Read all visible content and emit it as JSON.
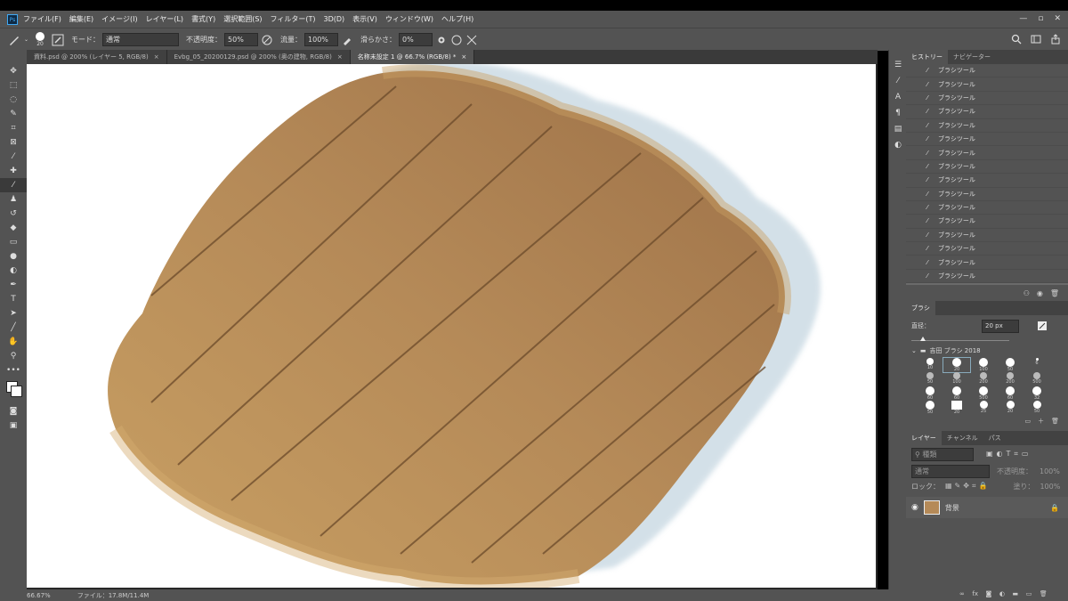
{
  "app": {
    "logo": "Ps"
  },
  "menu": [
    "ファイル(F)",
    "編集(E)",
    "イメージ(I)",
    "レイヤー(L)",
    "書式(Y)",
    "選択範囲(S)",
    "フィルター(T)",
    "3D(D)",
    "表示(V)",
    "ウィンドウ(W)",
    "ヘルプ(H)"
  ],
  "window_controls": [
    "—",
    "▫",
    "✕"
  ],
  "options": {
    "brush_size": "20",
    "mode_label": "モード：",
    "mode_value": "通常",
    "opacity_label": "不透明度：",
    "opacity_value": "50%",
    "flow_label": "流量：",
    "flow_value": "100%",
    "smoothing_label": "滑らかさ：",
    "smoothing_value": "0%"
  },
  "tabs": [
    {
      "label": "資料.psd @ 200% (レイヤー 5, RGB/8)",
      "active": false
    },
    {
      "label": "Evbg_05_20200129.psd @ 200% (奥の建物, RGB/8)",
      "active": false
    },
    {
      "label": "名称未設定 1 @ 66.7% (RGB/8) *",
      "active": true
    }
  ],
  "tab_close": "×",
  "status": {
    "zoom": "66.67%",
    "file": "ファイル：17.8M/11.4M"
  },
  "history": {
    "tab_history": "ヒストリー",
    "tab_navigator": "ナビゲーター",
    "item_label": "ブラシツール",
    "item_count": 17
  },
  "brush_panel": {
    "title": "ブラシ",
    "size_label": "直径：",
    "size_value": "20 px",
    "folder_name": "吉田 ブラシ 2018",
    "sizes": [
      "10",
      "20",
      "100",
      "50",
      "6",
      "50",
      "100",
      "200",
      "200",
      "500",
      "60",
      "60",
      "500",
      "60",
      "32",
      "50",
      "20",
      "25",
      "20",
      "50"
    ]
  },
  "layers": {
    "tabs": [
      "レイヤー",
      "チャンネル",
      "パス"
    ],
    "search_placeholder": "種類",
    "blend_mode": "通常",
    "opacity_label": "不透明度：",
    "opacity_value": "100%",
    "lock_label": "ロック：",
    "fill_label": "塗り：",
    "fill_value": "100%",
    "layer_name": "背景"
  },
  "colors": {
    "ui": "#535353",
    "dark": "#3a3a3a",
    "accent": "#3fa9f5",
    "paint_light": "#c9a063",
    "paint_dark": "#9c7047",
    "stripe": "#6b4a2a"
  }
}
